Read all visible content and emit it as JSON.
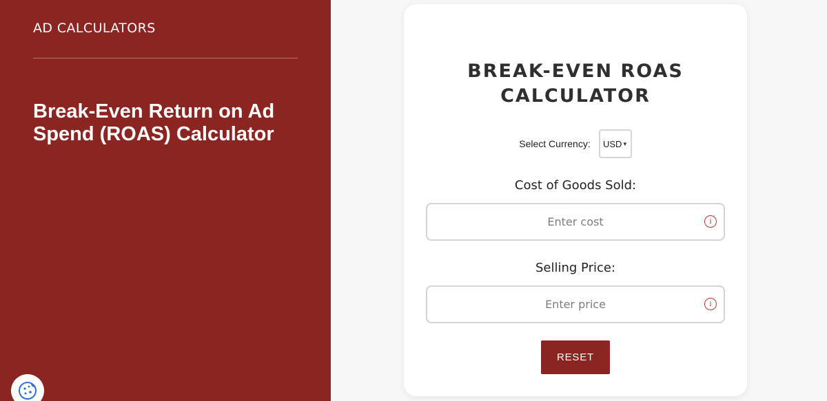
{
  "sidebar": {
    "brand": "AD CALCULATORS",
    "hero_title": "Break-Even Return on Ad Spend (ROAS) Calculator"
  },
  "calculator": {
    "title": "BREAK-EVEN ROAS CALCULATOR",
    "currency": {
      "label": "Select Currency:",
      "selected": "USD"
    },
    "fields": {
      "cost": {
        "label": "Cost of Goods Sold:",
        "placeholder": "Enter cost",
        "value": ""
      },
      "price": {
        "label": "Selling Price:",
        "placeholder": "Enter price",
        "value": ""
      }
    },
    "reset_label": "RESET"
  },
  "icons": {
    "info": "info-icon",
    "cookie": "cookie-icon",
    "caret": "caret-down-icon"
  },
  "colors": {
    "brand_red": "#8b2521",
    "info_red": "#b23a2f",
    "cookie_blue": "#2f6fd8"
  }
}
